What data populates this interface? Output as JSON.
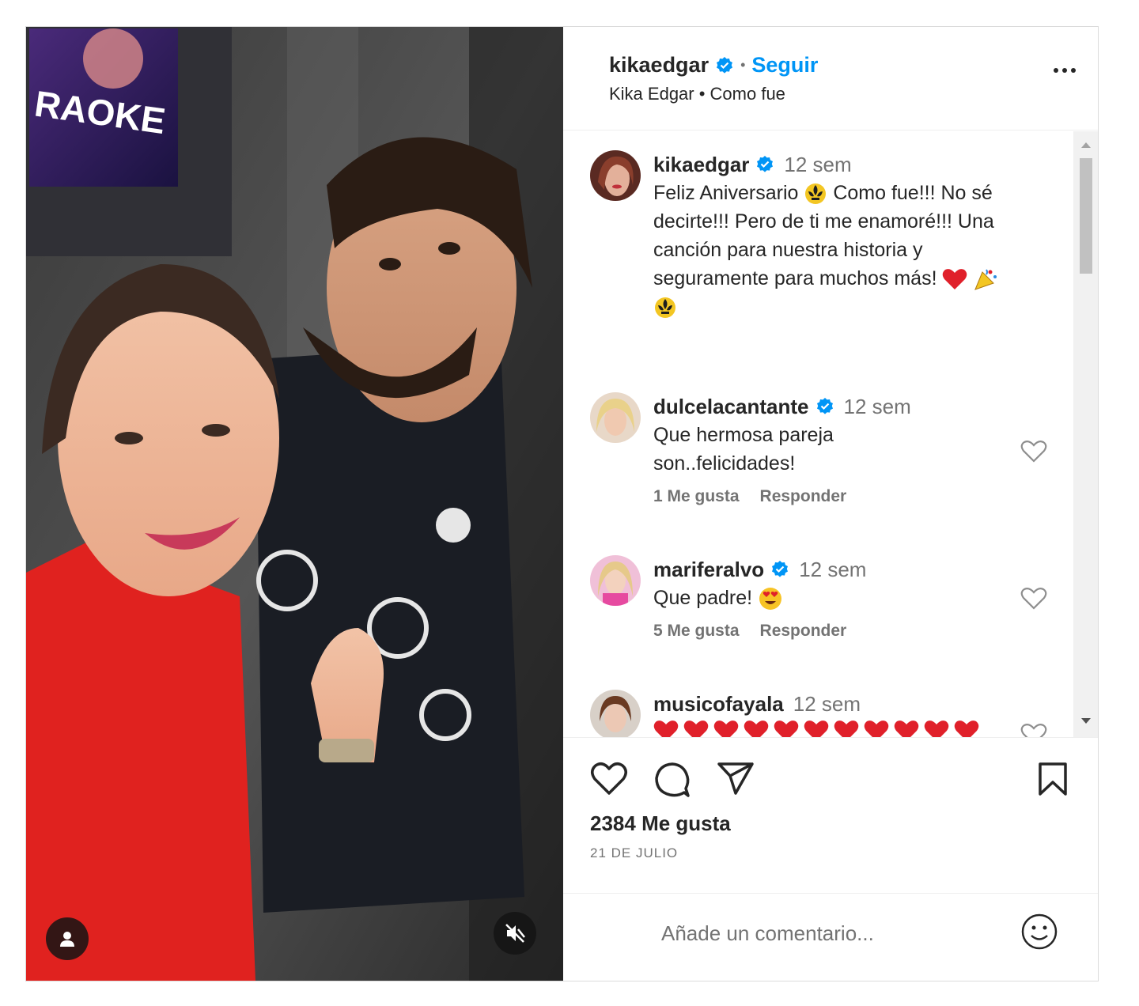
{
  "header": {
    "username": "kikaedgar",
    "follow_label": "Seguir",
    "subtitle": "Kika Edgar • Como fue",
    "dot": "•"
  },
  "caption": {
    "username": "kikaedgar",
    "time": "12 sem",
    "text": "Feliz Aniversario ⚜️ Como fue!!! No sé decirte!!! Pero de ti me enamoré!!! Una canción para nuestra historia y seguramente para muchos más! ❤️ 🎉 ⚜️",
    "line1a": "Feliz Aniversario",
    "line1b": "Como fue!!! No sé",
    "line2": "decirte!!! Pero de ti me enamoré!!! Una",
    "line3": "canción para nuestra historia y",
    "line4": "seguramente para muchos más!"
  },
  "comments": [
    {
      "username": "dulcelacantante",
      "time": "12 sem",
      "line1": "Que hermosa pareja",
      "line2": "son..felicidades!",
      "likes": "1 Me gusta",
      "reply": "Responder"
    },
    {
      "username": "mariferalvo",
      "time": "12 sem",
      "line1": "Que padre!",
      "likes": "5 Me gusta",
      "reply": "Responder"
    },
    {
      "username": "musicofayala",
      "time": "12 sem"
    }
  ],
  "actions": {
    "likes": "2384 Me gusta",
    "date": "21 DE JULIO"
  },
  "add_comment": {
    "placeholder": "Añade un comentario..."
  },
  "colors": {
    "accent": "#0095f6",
    "verified": "#0095f6",
    "text": "#262626",
    "muted": "#737373",
    "heart_emoji": "#e0202a"
  },
  "icons": [
    "verified-badge-icon",
    "more-options-icon",
    "like-icon",
    "comment-icon",
    "share-icon",
    "save-icon",
    "emoji-icon",
    "user-tag-icon",
    "muted-icon",
    "scroll-up-icon",
    "scroll-down-icon"
  ]
}
